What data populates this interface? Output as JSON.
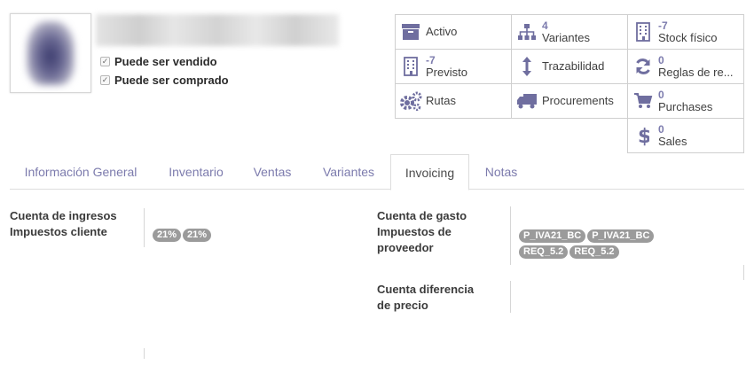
{
  "product": {
    "checkbox_mark": "✓",
    "can_be_sold_label": "Puede ser vendido",
    "can_be_purchased_label": "Puede ser comprado"
  },
  "smart_buttons": {
    "activo": {
      "label": "Activo",
      "icon": "archive-icon"
    },
    "variantes": {
      "count": "4",
      "label": "Variantes",
      "icon": "sitemap-icon"
    },
    "stock_fisico": {
      "count": "-7",
      "label": "Stock físico",
      "icon": "building-icon"
    },
    "previsto": {
      "count": "-7",
      "label": "Previsto",
      "icon": "building-icon"
    },
    "trazabilidad": {
      "label": "Trazabilidad",
      "icon": "arrows-vertical-icon"
    },
    "reglas": {
      "count": "0",
      "label": "Reglas de re...",
      "icon": "refresh-icon"
    },
    "rutas": {
      "label": "Rutas",
      "icon": "cogs-icon"
    },
    "procurements": {
      "label": "Procurements",
      "icon": "truck-icon"
    },
    "purchases": {
      "count": "0",
      "label": "Purchases",
      "icon": "shopping-cart-icon"
    },
    "sales": {
      "count": "0",
      "label": "Sales",
      "icon": "dollar-icon"
    }
  },
  "tabs": [
    {
      "label": "Información General",
      "active": false
    },
    {
      "label": "Inventario",
      "active": false
    },
    {
      "label": "Ventas",
      "active": false
    },
    {
      "label": "Variantes",
      "active": false
    },
    {
      "label": "Invoicing",
      "active": true
    },
    {
      "label": "Notas",
      "active": false
    }
  ],
  "invoicing": {
    "income_account_label": "Cuenta de ingresos",
    "customer_taxes_label": "Impuestos cliente",
    "customer_taxes": [
      "21%",
      "21%"
    ],
    "expense_account_label": "Cuenta de gasto",
    "vendor_taxes_label_1": "Impuestos de",
    "vendor_taxes_label_2": "proveedor",
    "vendor_taxes": [
      "P_IVA21_BC",
      "P_IVA21_BC",
      "REQ_5.2",
      "REQ_5.2"
    ],
    "price_diff_label_1": "Cuenta diferencia",
    "price_diff_label_2": "de precio"
  },
  "colors": {
    "accent": "#7c7bad",
    "badge": "#9b9b9b",
    "border": "#dddddd"
  }
}
